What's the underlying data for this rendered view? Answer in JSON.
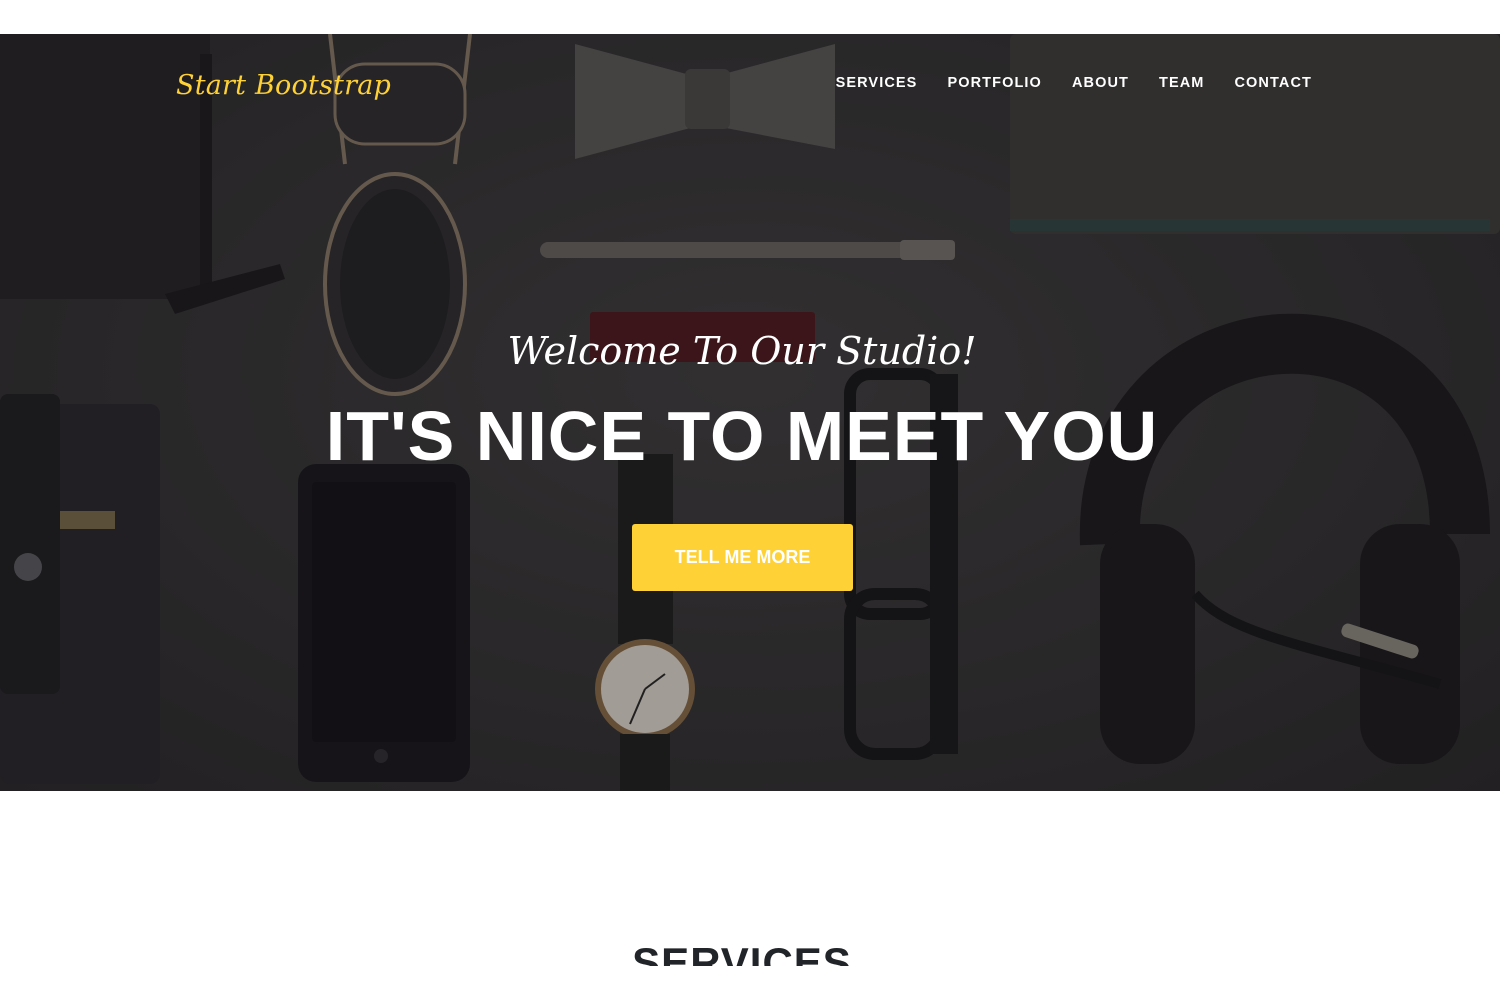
{
  "brand": {
    "name": "Start Bootstrap"
  },
  "nav": {
    "items": [
      {
        "label": "SERVICES"
      },
      {
        "label": "PORTFOLIO"
      },
      {
        "label": "ABOUT"
      },
      {
        "label": "TEAM"
      },
      {
        "label": "CONTACT"
      }
    ]
  },
  "hero": {
    "lead_in": "Welcome To Our Studio!",
    "heading": "IT'S NICE TO MEET YOU",
    "button_label": "TELL ME MORE"
  },
  "services": {
    "heading": "SERVICES"
  },
  "colors": {
    "accent": "#fed136",
    "hero_overlay": "#2f2e2f",
    "nav_text": "#ffffff",
    "heading_text": "#212529"
  }
}
